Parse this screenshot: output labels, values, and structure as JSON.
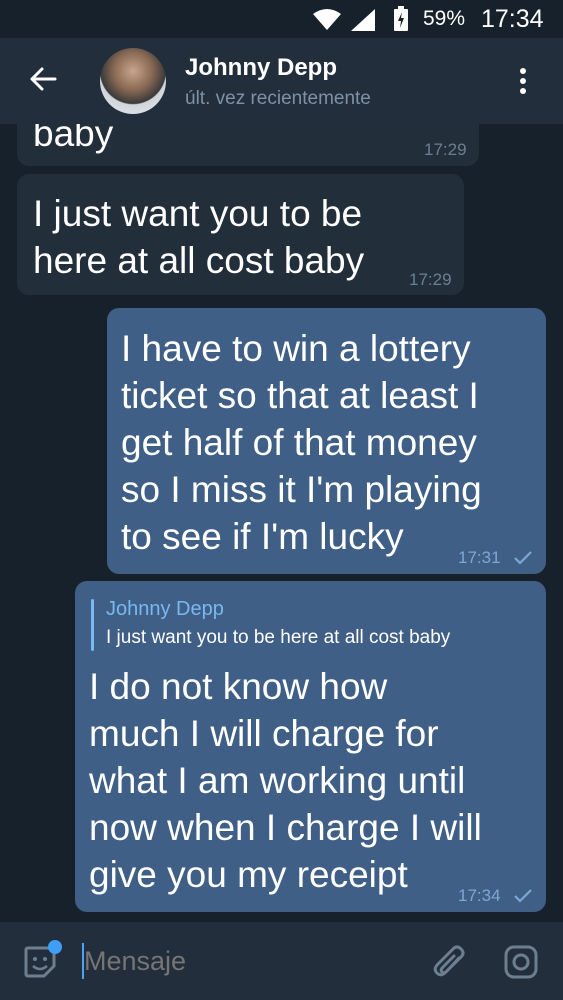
{
  "status_bar": {
    "battery": "59%",
    "time": "17:34"
  },
  "header": {
    "contact_name": "Johnny Depp",
    "last_seen": "últ. vez recientemente"
  },
  "messages": [
    {
      "direction": "in",
      "text": "baby",
      "time": "17:29"
    },
    {
      "direction": "in",
      "text_lines": [
        "I just want you to be",
        "here at all cost baby"
      ],
      "time": "17:29"
    },
    {
      "direction": "out",
      "text_lines": [
        "I have to win a lottery",
        "ticket so that at least I",
        "get half of that money",
        "so I miss it I'm playing",
        "to see if I'm lucky"
      ],
      "time": "17:31",
      "status": "sent"
    },
    {
      "direction": "out",
      "reply_to": {
        "name": "Johnny Depp",
        "text": "I just want you to be here at all cost baby"
      },
      "text_lines": [
        "I do not know how",
        "much I will charge for",
        "what I am working until",
        "now when I charge I will",
        "give you my receipt"
      ],
      "time": "17:34",
      "status": "sent"
    }
  ],
  "composer": {
    "placeholder": "Mensaje"
  },
  "icons": [
    "wifi-icon",
    "signal-icon",
    "battery-icon",
    "back-arrow-icon",
    "more-vert-icon",
    "sticker-icon",
    "attach-icon",
    "camera-icon",
    "check-icon"
  ],
  "colors": {
    "background": "#17212b",
    "header": "#232e3c",
    "incoming": "#222e3a",
    "outgoing": "#3f5f86",
    "accent": "#77b9f0"
  }
}
